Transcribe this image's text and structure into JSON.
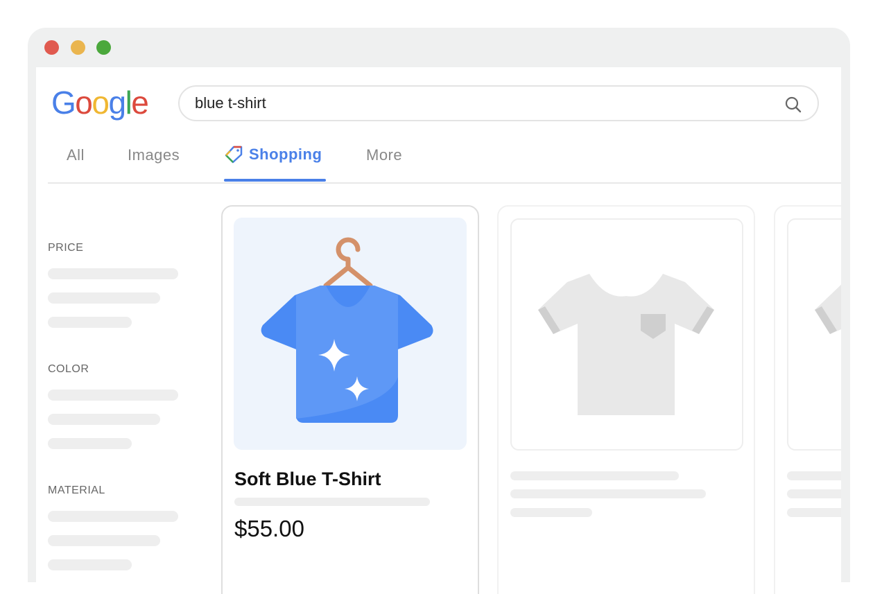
{
  "window": {
    "controls": [
      {
        "name": "close",
        "color": "#e05a4f"
      },
      {
        "name": "minimize",
        "color": "#eab54e"
      },
      {
        "name": "maximize",
        "color": "#4ba83c"
      }
    ]
  },
  "logo": {
    "text": "Google",
    "letters": [
      {
        "c": "G",
        "color": "#4a80e8"
      },
      {
        "c": "o",
        "color": "#dc4a3d"
      },
      {
        "c": "o",
        "color": "#f0b732"
      },
      {
        "c": "g",
        "color": "#4a80e8"
      },
      {
        "c": "l",
        "color": "#3ca655"
      },
      {
        "c": "e",
        "color": "#dc4a3d"
      }
    ]
  },
  "search": {
    "value": "blue t-shirt",
    "icon": "search-icon"
  },
  "tabs": [
    {
      "label": "All"
    },
    {
      "label": "Images"
    },
    {
      "label": "Shopping",
      "active": true,
      "icon": "price-tag-icon"
    },
    {
      "label": "More"
    }
  ],
  "filters": [
    {
      "label": "PRICE"
    },
    {
      "label": "COLOR"
    },
    {
      "label": "MATERIAL"
    }
  ],
  "products": [
    {
      "title": "Soft Blue T-Shirt",
      "price": "$55.00",
      "image": "blue-tshirt-on-hanger"
    }
  ],
  "colors": {
    "accent": "#4a80e8",
    "shirt": "#4a8af4",
    "hanger": "#d4916a"
  }
}
